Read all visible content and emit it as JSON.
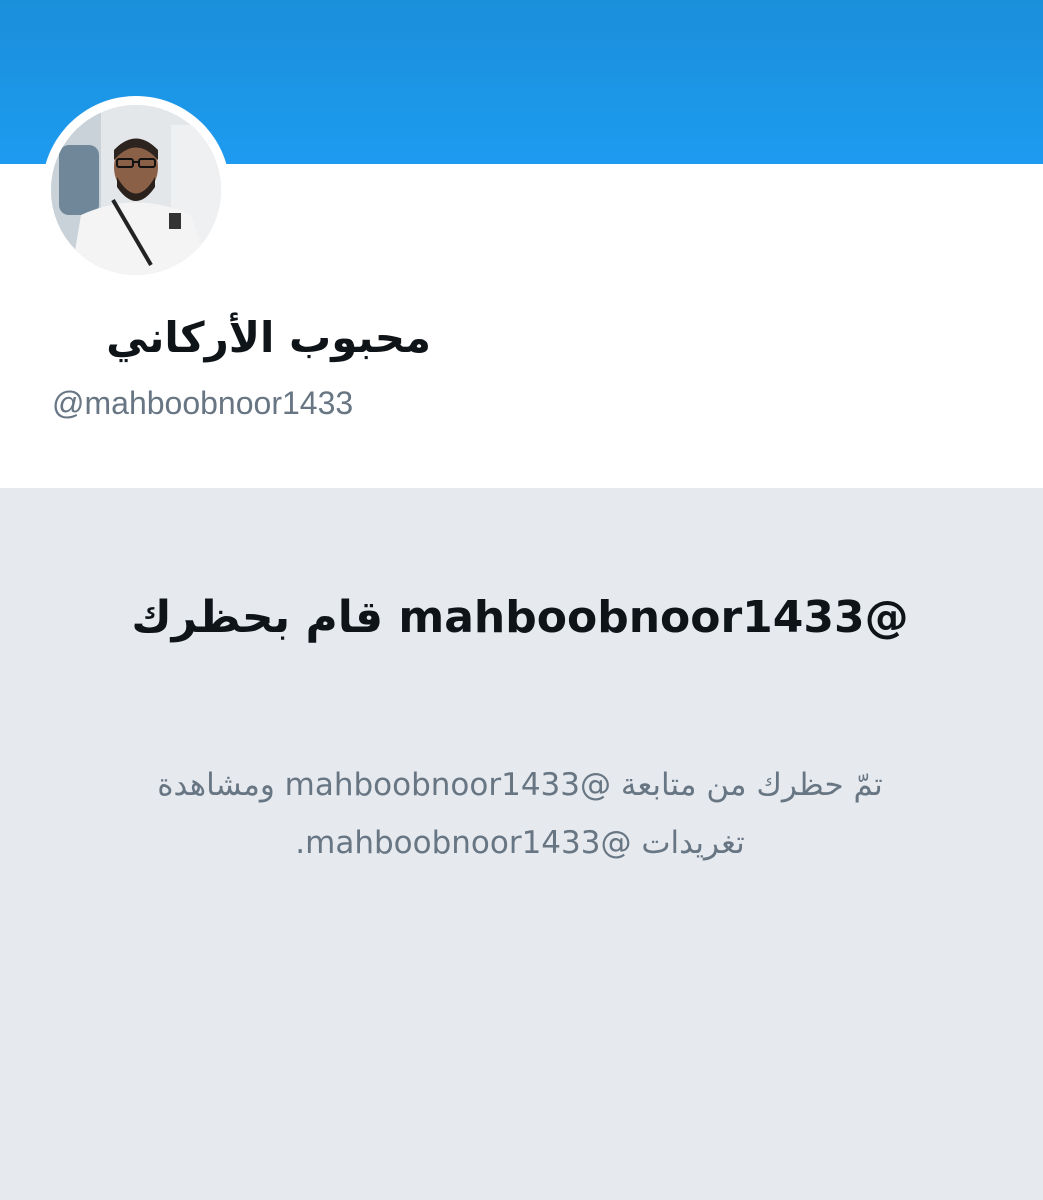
{
  "profile": {
    "display_name": "محبوب الأركاني",
    "handle": "@mahboobnoor1433"
  },
  "blocked": {
    "title": "@mahboobnoor1433 قام بحظرك",
    "message": "تمّ حظرك من متابعة @mahboobnoor1433 ومشاهدة تغريدات @mahboobnoor1433."
  },
  "colors": {
    "banner": "#1d9bf0",
    "panel_background": "#e6eaef",
    "secondary_text": "#687684",
    "primary_text": "#0f1419"
  }
}
